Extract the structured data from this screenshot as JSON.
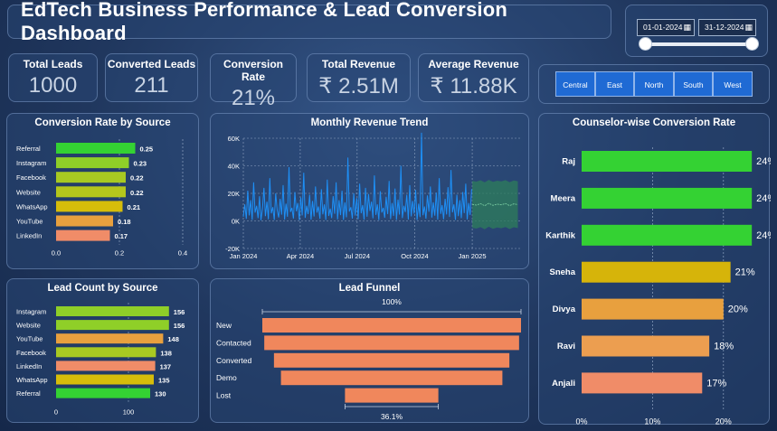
{
  "header": {
    "title": "EdTech Business Performance & Lead Conversion Dashboard"
  },
  "date_filter": {
    "start": "01-01-2024",
    "end": "31-12-2024",
    "calendar_icon": "calendar-icon"
  },
  "kpis": [
    {
      "label": "Total Leads",
      "value": "1000"
    },
    {
      "label": "Converted Leads",
      "value": "211"
    },
    {
      "label": "Conversion Rate",
      "value": "21%"
    },
    {
      "label": "Total Revenue",
      "value": "₹ 2.51M"
    },
    {
      "label": "Average Revenue",
      "value": "₹ 11.88K"
    }
  ],
  "region_slicer": {
    "options": [
      "Central",
      "East",
      "North",
      "South",
      "West"
    ],
    "color": "#1f6ad4"
  },
  "chart_data": [
    {
      "id": "conv_by_source",
      "type": "bar",
      "orientation": "horizontal",
      "title": "Conversion Rate by Source",
      "categories": [
        "Referral",
        "Instagram",
        "Facebook",
        "Website",
        "WhatsApp",
        "YouTube",
        "LinkedIn"
      ],
      "values": [
        0.25,
        0.23,
        0.22,
        0.22,
        0.21,
        0.18,
        0.17
      ],
      "value_labels": [
        "0.25",
        "0.23",
        "0.22",
        "0.22",
        "0.21",
        "0.18",
        "0.17"
      ],
      "colors": [
        "#34d233",
        "#8fcf28",
        "#a8c922",
        "#b4c61c",
        "#d6bd0a",
        "#e8a03e",
        "#f08c68"
      ],
      "xlim": [
        0,
        0.4
      ],
      "xticks": [
        "0.0",
        "0.2",
        "0.4"
      ],
      "grid": true
    },
    {
      "id": "lead_count_by_source",
      "type": "bar",
      "orientation": "horizontal",
      "title": "Lead Count by Source",
      "categories": [
        "Instagram",
        "Website",
        "YouTube",
        "Facebook",
        "LinkedIn",
        "WhatsApp",
        "Referral"
      ],
      "values": [
        156,
        156,
        148,
        138,
        137,
        135,
        130
      ],
      "value_labels": [
        "156",
        "156",
        "148",
        "138",
        "137",
        "135",
        "130"
      ],
      "colors": [
        "#8fcf28",
        "#8fcf28",
        "#e8a03e",
        "#a8c922",
        "#f08c68",
        "#d6bd0a",
        "#34d233"
      ],
      "xlim": [
        0,
        160
      ],
      "xticks": [
        "0",
        "100"
      ],
      "grid": true
    },
    {
      "id": "monthly_revenue",
      "type": "line",
      "title": "Monthly Revenue Trend",
      "x_range": [
        "2024-01-01",
        "2025-03-20"
      ],
      "x_ticks": [
        "Jan 2024",
        "Apr 2024",
        "Jul 2024",
        "Oct 2024",
        "Jan 2025"
      ],
      "y_ticks": [
        "-20K",
        "0K",
        "20K",
        "40K",
        "60K"
      ],
      "ylim": [
        -20000,
        60000
      ],
      "series": [
        {
          "role": "actual",
          "color": "#1e8ff5",
          "values": [
            3000,
            12000,
            1500,
            22000,
            4000,
            15000,
            800,
            28000,
            6000,
            11000,
            2000,
            18000,
            500,
            9000,
            24000,
            3500,
            14000,
            1200,
            31000,
            5500,
            10000,
            700,
            20000,
            8000,
            2500,
            16000,
            4500,
            26000,
            1000,
            12500,
            3000,
            39000,
            6500,
            9500,
            1800,
            21000,
            7000,
            13000,
            600,
            17000,
            4000,
            35000,
            2200,
            11000,
            5000,
            19000,
            900,
            14500,
            3200,
            25000,
            6000,
            10500,
            1500,
            23000,
            4800,
            12000,
            700,
            30000,
            3600,
            9000,
            2000,
            18000,
            5200,
            28000,
            1100,
            15000,
            4200,
            22000,
            800,
            13500,
            2600,
            46000,
            6800,
            10000,
            1700,
            20000,
            3900,
            16500,
            1300,
            27000,
            5600,
            11500,
            900,
            24000,
            3100,
            19500,
            7200,
            14000,
            1900,
            33000,
            4400,
            12000,
            600,
            21500,
            6100,
            9500,
            2300,
            17500,
            5000,
            29000,
            1400,
            13000,
            3700,
            23500,
            800,
            15500,
            4600,
            40000,
            2100,
            11000,
            6400,
            19000,
            1000,
            26000,
            3300,
            14500,
            5300,
            22500,
            700,
            12500,
            2800,
            64000,
            4100,
            10500,
            1600,
            18500,
            6700,
            25000,
            2400,
            13500,
            3800,
            20500,
            900,
            31000,
            5100,
            11500,
            1200,
            16000,
            4700,
            24500,
            2900,
            37000,
            6200,
            12000,
            800,
            19000,
            3500,
            15000,
            2000,
            21000,
            5700,
            27000,
            1100,
            13000,
            4300,
            23000
          ]
        },
        {
          "role": "forecast",
          "color": "#2b8a5c",
          "band_color": "#2e7d5b",
          "values": [
            12000,
            11500,
            12500,
            11000,
            12800,
            11300,
            12200,
            11700,
            12600,
            11100,
            12400,
            11800
          ]
        }
      ]
    },
    {
      "id": "lead_funnel",
      "type": "funnel",
      "title": "Lead Funnel",
      "categories": [
        "New",
        "Contacted",
        "Converted",
        "Demo",
        "Lost"
      ],
      "values": [
        100,
        98.5,
        91,
        85.6,
        36.1
      ],
      "color": "#f0875c",
      "top_label": "100%",
      "bottom_label": "36.1%"
    },
    {
      "id": "counselor_conversion",
      "type": "bar",
      "orientation": "horizontal",
      "title": "Counselor-wise Conversion Rate",
      "categories": [
        "Raj",
        "Meera",
        "Karthik",
        "Sneha",
        "Divya",
        "Ravi",
        "Anjali"
      ],
      "values": [
        0.24,
        0.24,
        0.24,
        0.21,
        0.2,
        0.18,
        0.17
      ],
      "value_labels": [
        "24%",
        "24%",
        "24%",
        "21%",
        "20%",
        "18%",
        "17%"
      ],
      "colors": [
        "#34d233",
        "#34d233",
        "#34d233",
        "#d6b40a",
        "#e8a03e",
        "#ec9e50",
        "#f08c68"
      ],
      "xlim": [
        0,
        0.25
      ],
      "xticks": [
        "0%",
        "10%",
        "20%"
      ],
      "grid": true
    }
  ]
}
